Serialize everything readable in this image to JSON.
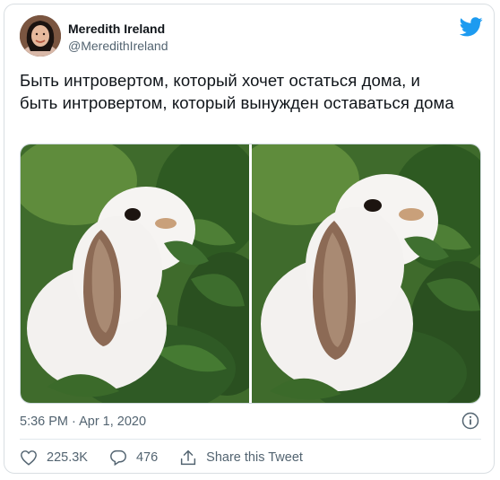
{
  "author": {
    "name": "Meredith Ireland",
    "handle": "@MeredithIreland"
  },
  "tweet": {
    "line1": "Быть интровертом, который хочет остаться дома, и",
    "line2": "быть интровертом, который вынужден оставаться дома"
  },
  "meta": {
    "timestamp": "5:36 PM · Apr 1, 2020"
  },
  "actions": {
    "likes": "225.3K",
    "replies": "476",
    "share_label": "Share this Tweet"
  },
  "colors": {
    "brand": "#1d9bf0",
    "muted": "#536471",
    "text": "#0f1419"
  },
  "icons": [
    "twitter-bird-icon",
    "info-icon",
    "heart-icon",
    "reply-icon",
    "share-icon"
  ]
}
